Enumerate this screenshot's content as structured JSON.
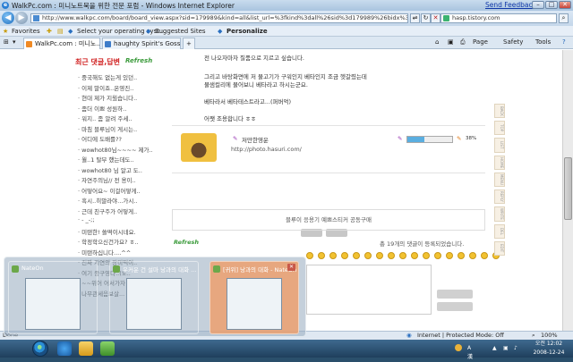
{
  "window": {
    "title": "WalkPc.com : 미니노트북을 위한 전문 포럼 - Windows Internet Explorer",
    "send_feedback": "Send Feedback",
    "min_label": "–",
    "max_label": "□",
    "close_label": "✕"
  },
  "address_bar": {
    "url": "http://www.walkpc.com/board/board_view.aspx?sid=179989&kind=all&list_url=%3fkind%3dall%26sid%3d179989%26bidx%3d179989%26bidx%3d",
    "search_text": "hasp.tistory.com",
    "back": "◀",
    "forward": "▶",
    "refresh": "↻",
    "stop": "✕",
    "compat": "⇌"
  },
  "favorites_bar": {
    "favorites": "Favorites",
    "item1": "Select your operating syst...",
    "item2": "Suggested Sites",
    "item3": "Personalize"
  },
  "tabs": [
    {
      "label": "WalkPc.com : 미니노..."
    },
    {
      "label": "haughty Spirit's Gossip ::..."
    }
  ],
  "toolbar_right": {
    "page": "Page",
    "safety": "Safety",
    "tools": "Tools"
  },
  "sidebar": {
    "title": "최근 댓글,답변",
    "refresh": "Refresh",
    "items": [
      "중국해도 없는게 있던..",
      "이제 말이죠..온영진..",
      "현대 제가 지웠습니다..",
      "좀더 이쁘 성원하..",
      "워지.. 좀 알려 주세..",
      "마침 블루님이 게시는..",
      "어디에 도배를??",
      "wowhot80님~~~~ 제가..",
      "월..1 탈부 했는데도..",
      "wowhot80 님 알고 도..",
      "자연주의님// 전 용이..",
      "어떻어요~ 이걸어떻게..",
      "흑시..히말라야...가시..",
      "근데 친구주가 어떻게..",
      "- _-;;",
      "미탠한! 쓸떡이시네요.",
      "학정학으신건가요? ㅎ..",
      "미탠하십니다....^^",
      "진짜 지연의 장미떡이..",
      "여기 중구영다..(노..",
      "~~위어 어서가자 다고..",
      "나무관세음보살..."
    ]
  },
  "main": {
    "line1": "전 나오자마자 질품으로 지르고 싶습니다.",
    "line2": "그리고 바탕화면에 저 물고기가 구워인지 베타인지 조금 헷갈렸는데",
    "line3": "물샘컬리에 물어보니 베타라고 하시는군요.",
    "line4": "베타라서 베타테스트라고...(퍼버억)",
    "line5": "어쨋 조용합니다 ㅎㅎ",
    "author_name": "저만한영운",
    "author_url": "http://photo.hasuri.com/",
    "gauge_percent": 0.38,
    "percent_label": "38%",
    "banner": "블루이 응용기 예쁘스티커 공동구매",
    "comment_refresh": "Refresh",
    "comment_count_text": "총 19개의 댓글이 등록되었습니다."
  },
  "right_tabs": [
    "BACK",
    "TOP",
    "LIST",
    "HOME",
    "MENU",
    "REPLY",
    "WRITE",
    "DEL",
    "EDIT"
  ],
  "status": {
    "left": "Done",
    "zone": "Internet | Protected Mode: Off",
    "zoom": "100%"
  },
  "taskbar": {
    "time": "오전 12:02",
    "date": "2008-12-24",
    "lang": "A 漢"
  },
  "thumbnails": [
    {
      "title": "NateOn"
    },
    {
      "title": "우커운 건 설마 낭과의 대화 ..."
    },
    {
      "title": "[귀위] 낭과의 대화 - NateOn"
    }
  ]
}
